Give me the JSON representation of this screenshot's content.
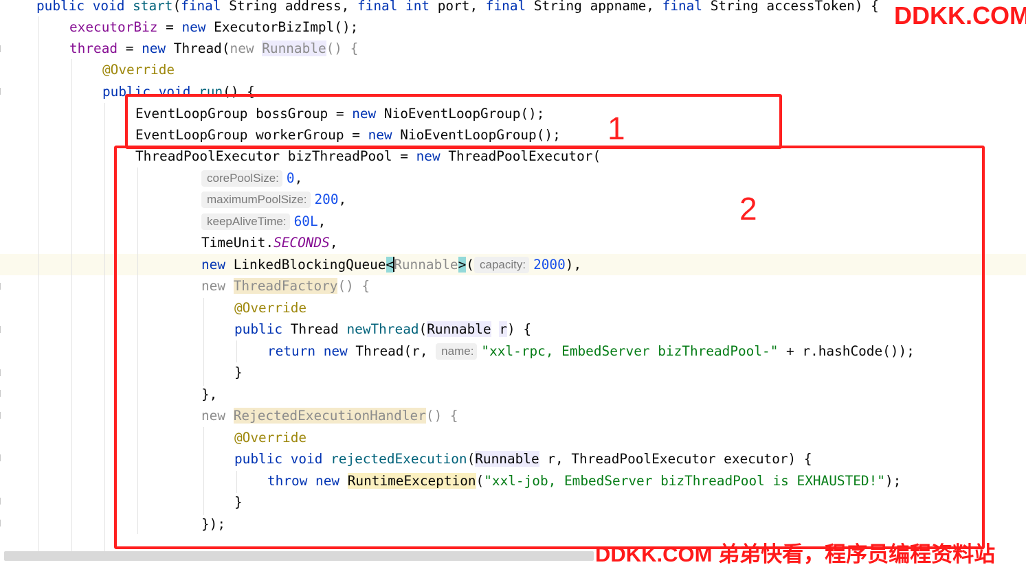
{
  "editor": {
    "lines": {
      "l1": {
        "a": "public void ",
        "b": "start",
        "c": "(",
        "d": "final ",
        "e": "String address, ",
        "f": "final int ",
        "g": "port, ",
        "h": "final ",
        "i": "String appname, ",
        "j": "final ",
        "k": "String accessToken) {"
      },
      "l2": {
        "a": "executorBiz",
        "b": " = ",
        "c": "new ",
        "d": "ExecutorBizImpl();"
      },
      "l3": {
        "a": "thread",
        "b": " = ",
        "c": "new ",
        "d": "Thread(",
        "e": "new ",
        "f": "Runnable",
        "g": "() {"
      },
      "l4": {
        "a": "@Override"
      },
      "l5": {
        "a": "public void ",
        "b": "run",
        "c": "() {"
      },
      "l6": {
        "a": "EventLoopGroup bossGroup = ",
        "b": "new ",
        "c": "NioEventLoopGroup();"
      },
      "l7": {
        "a": "EventLoopGroup workerGroup = ",
        "b": "new ",
        "c": "NioEventLoopGroup();"
      },
      "l8": {
        "a": "ThreadPoolExecutor bizThreadPool = ",
        "b": "new ",
        "c": "ThreadPoolExecutor("
      },
      "l9": {
        "hint": "corePoolSize:",
        "num": "0",
        "tail": ","
      },
      "l10": {
        "hint": "maximumPoolSize:",
        "num": "200",
        "tail": ","
      },
      "l11": {
        "hint": "keepAliveTime:",
        "num": "60L",
        "tail": ","
      },
      "l12": {
        "a": "TimeUnit.",
        "b": "SECONDS",
        "c": ","
      },
      "l13": {
        "a": "new ",
        "b": "LinkedBlockingQueue",
        "c": "<",
        "d": "Runnable",
        "e": ">",
        "f": "(",
        "hint": "capacity:",
        "num": "2000",
        "g": "),"
      },
      "l14": {
        "a": "new ",
        "b": "ThreadFactory",
        "c": "() {"
      },
      "l15": {
        "a": "@Override"
      },
      "l16": {
        "a": "public ",
        "b": "Thread ",
        "c": "newThread",
        "d": "(",
        "e": "Runnable",
        "f": " ",
        "g": "r",
        "h": ") {"
      },
      "l17": {
        "a": "return new ",
        "b": "Thread(r, ",
        "hint": "name:",
        "str": "\"xxl-rpc, EmbedServer bizThreadPool-\"",
        "c": " + r.hashCode());"
      },
      "l18": {
        "a": "}"
      },
      "l19": {
        "a": "},"
      },
      "l20": {
        "a": "new ",
        "b": "RejectedExecutionHandler",
        "c": "() {"
      },
      "l21": {
        "a": "@Override"
      },
      "l22": {
        "a": "public void ",
        "b": "rejectedExecution",
        "c": "(",
        "d": "Runnable",
        "e": " r, ThreadPoolExecutor executor) {"
      },
      "l23": {
        "a": "throw new ",
        "b": "RuntimeException",
        "c": "(",
        "str": "\"xxl-job, EmbedServer bizThreadPool is EXHAUSTED!\"",
        "d": ");"
      },
      "l24": {
        "a": "}"
      },
      "l25": {
        "a": "});"
      }
    }
  },
  "annotations": {
    "box1_label": "1",
    "box2_label": "2"
  },
  "watermarks": {
    "top": "DDKK.COM",
    "bottom": "DDKK.COM 弟弟快看，程序员编程资料站"
  },
  "colors": {
    "keyword": "#0033b3",
    "field": "#871094",
    "string": "#067d17",
    "number": "#1750eb",
    "annotation": "#9e880d",
    "method": "#00627a",
    "highlight_box": "#ff2020"
  }
}
